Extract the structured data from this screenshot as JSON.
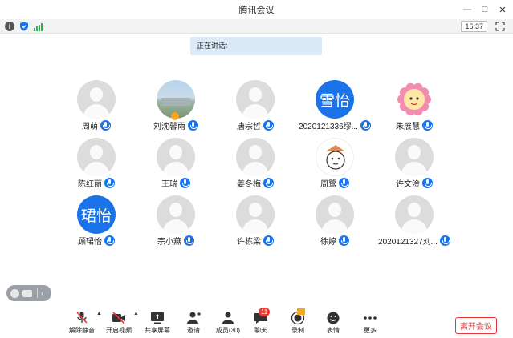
{
  "window": {
    "title": "腾讯会议"
  },
  "statusbar": {
    "time": "16:37"
  },
  "speaking_label": "正在讲话:",
  "participants": [
    {
      "name": "周萌",
      "avatar": "default"
    },
    {
      "name": "刘沈馨雨",
      "avatar": "photo"
    },
    {
      "name": "唐宗哲",
      "avatar": "default"
    },
    {
      "name": "2020121336缪...",
      "avatar": "text",
      "avatar_text": "雪怡"
    },
    {
      "name": "朱展慧",
      "avatar": "sun"
    },
    {
      "name": "陈红丽",
      "avatar": "default"
    },
    {
      "name": "王瑞",
      "avatar": "default"
    },
    {
      "name": "姜冬梅",
      "avatar": "default"
    },
    {
      "name": "周鹭",
      "avatar": "draw"
    },
    {
      "name": "许文淦",
      "avatar": "default"
    },
    {
      "name": "顾珺怡",
      "avatar": "text",
      "avatar_text": "珺怡"
    },
    {
      "name": "宗小燕",
      "avatar": "default"
    },
    {
      "name": "许栋梁",
      "avatar": "default"
    },
    {
      "name": "徐婷",
      "avatar": "default"
    },
    {
      "name": "2020121327刘...",
      "avatar": "default"
    }
  ],
  "toolbar": {
    "unmute": "解除静音",
    "start_video": "开启视频",
    "share_screen": "共享屏幕",
    "invite": "邀请",
    "members": "成员(30)",
    "chat": "聊天",
    "chat_badge": "11",
    "record": "录制",
    "reactions": "表情",
    "more": "更多",
    "leave": "离开会议"
  },
  "colors": {
    "accent": "#1a73e8",
    "danger": "#e53935",
    "signal": "#2bb24c"
  }
}
